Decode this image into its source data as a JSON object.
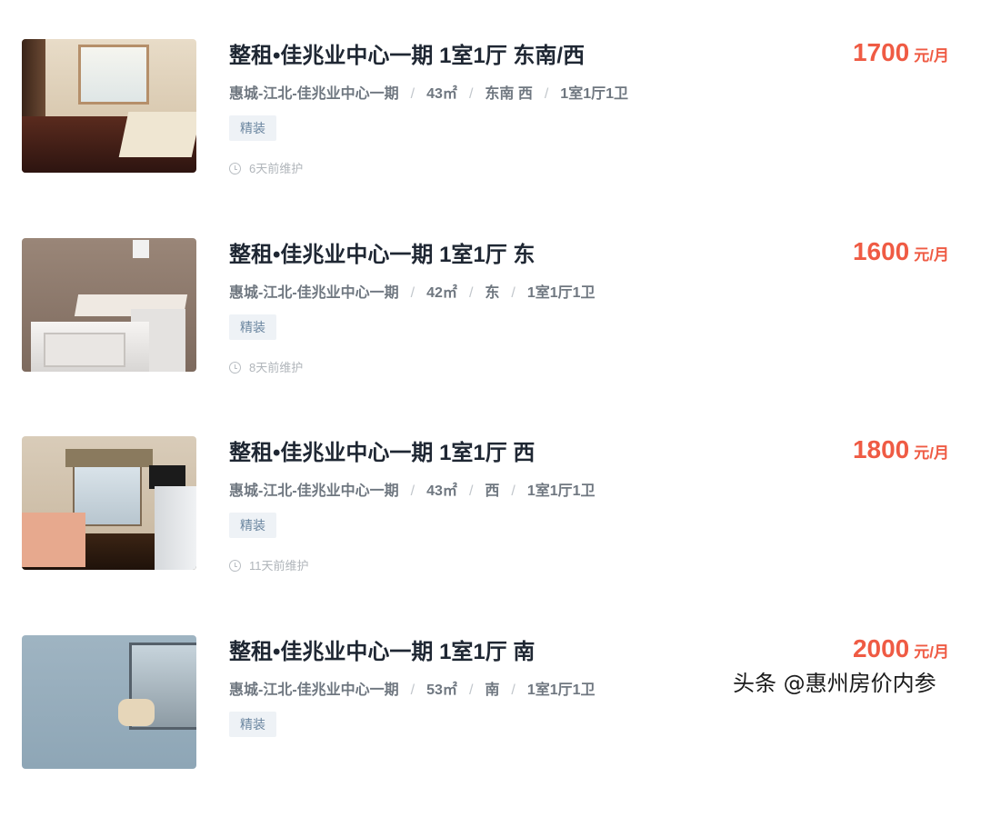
{
  "listings": [
    {
      "title": "整租•佳兆业中心一期 1室1厅 东南/西",
      "price": "1700",
      "price_unit": "元/月",
      "district": "惠城-江北-佳兆业中心一期",
      "area": "43㎡",
      "orientation": "东南 西",
      "layout": "1室1厅1卫",
      "tag": "精装",
      "maintained": "6天前维护"
    },
    {
      "title": "整租•佳兆业中心一期 1室1厅 东",
      "price": "1600",
      "price_unit": "元/月",
      "district": "惠城-江北-佳兆业中心一期",
      "area": "42㎡",
      "orientation": "东",
      "layout": "1室1厅1卫",
      "tag": "精装",
      "maintained": "8天前维护"
    },
    {
      "title": "整租•佳兆业中心一期 1室1厅 西",
      "price": "1800",
      "price_unit": "元/月",
      "district": "惠城-江北-佳兆业中心一期",
      "area": "43㎡",
      "orientation": "西",
      "layout": "1室1厅1卫",
      "tag": "精装",
      "maintained": "11天前维护"
    },
    {
      "title": "整租•佳兆业中心一期 1室1厅 南",
      "price": "2000",
      "price_unit": "元/月",
      "district": "惠城-江北-佳兆业中心一期",
      "area": "53㎡",
      "orientation": "南",
      "layout": "1室1厅1卫",
      "tag": "精装",
      "maintained": ""
    }
  ],
  "separator": "/",
  "watermark": "头条 @惠州房价内参",
  "colors": {
    "price": "#ef5b44",
    "title": "#1f2733",
    "tag_bg": "#eef2f6",
    "tag_text": "#6b86a0"
  }
}
